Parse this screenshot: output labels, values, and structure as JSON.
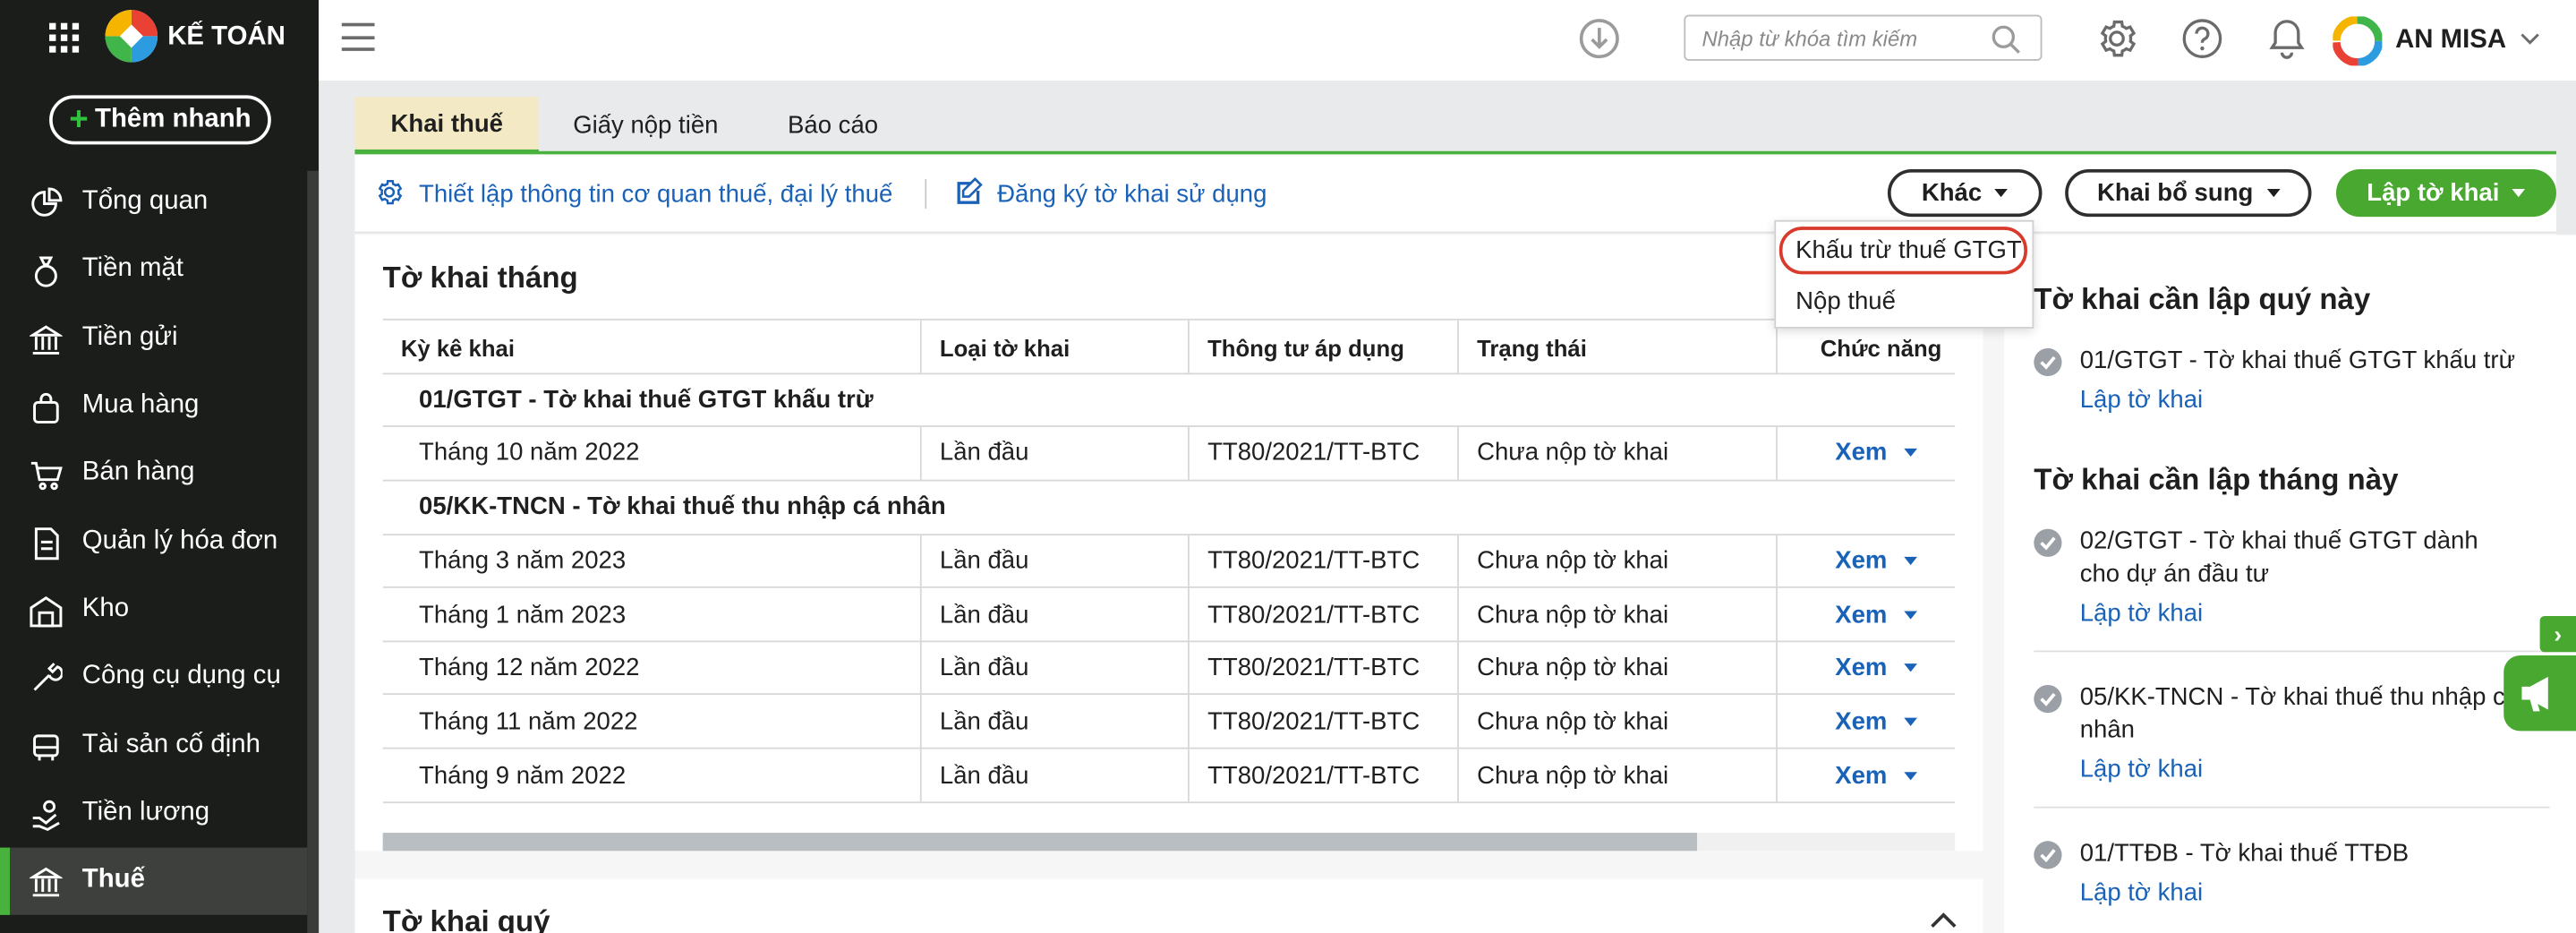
{
  "app": {
    "brand": "KẾ TOÁN",
    "quick_add": "Thêm nhanh"
  },
  "sidebar": {
    "items": [
      {
        "label": "Tổng quan",
        "icon": "chart-icon"
      },
      {
        "label": "Tiền mặt",
        "icon": "money-bag-icon"
      },
      {
        "label": "Tiền gửi",
        "icon": "bank-icon"
      },
      {
        "label": "Mua hàng",
        "icon": "shopping-bag-icon"
      },
      {
        "label": "Bán hàng",
        "icon": "cart-icon"
      },
      {
        "label": "Quản lý hóa đơn",
        "icon": "invoice-icon"
      },
      {
        "label": "Kho",
        "icon": "warehouse-icon"
      },
      {
        "label": "Công cụ dụng cụ",
        "icon": "tools-icon"
      },
      {
        "label": "Tài sản cố định",
        "icon": "asset-icon"
      },
      {
        "label": "Tiền lương",
        "icon": "salary-icon"
      },
      {
        "label": "Thuế",
        "icon": "tax-bank-icon",
        "active": true
      }
    ]
  },
  "header": {
    "search_placeholder": "Nhập từ khóa tìm kiếm",
    "user_name": "AN MISA"
  },
  "tabs": [
    "Khai thuế",
    "Giấy nộp tiền",
    "Báo cáo"
  ],
  "toolbar": {
    "setup_link": "Thiết lập thông tin cơ quan thuế, đại lý thuế",
    "register_link": "Đăng ký tờ khai sử dụng",
    "other_button": "Khác",
    "supplement_button": "Khai bổ sung",
    "create_button": "Lập tờ khai"
  },
  "dropdown": {
    "items": [
      "Khấu trừ thuế GTGT",
      "Nộp thuế"
    ]
  },
  "monthly": {
    "title": "Tờ khai tháng",
    "columns": [
      "Kỳ kê khai",
      "Loại tờ khai",
      "Thông tư áp dụng",
      "Trạng thái",
      "Chức năng"
    ],
    "groups": [
      "01/GTGT - Tờ khai thuế GTGT khấu trừ",
      "05/KK-TNCN - Tờ khai thuế thu nhập cá nhân"
    ],
    "rows": [
      {
        "period": "Tháng 10 năm 2022",
        "type": "Lần đầu",
        "circular": "TT80/2021/TT-BTC",
        "status": "Chưa nộp tờ khai",
        "action": "Xem"
      },
      {
        "period": "Tháng 3 năm 2023",
        "type": "Lần đầu",
        "circular": "TT80/2021/TT-BTC",
        "status": "Chưa nộp tờ khai",
        "action": "Xem"
      },
      {
        "period": "Tháng 1 năm 2023",
        "type": "Lần đầu",
        "circular": "TT80/2021/TT-BTC",
        "status": "Chưa nộp tờ khai",
        "action": "Xem"
      },
      {
        "period": "Tháng 12 năm 2022",
        "type": "Lần đầu",
        "circular": "TT80/2021/TT-BTC",
        "status": "Chưa nộp tờ khai",
        "action": "Xem"
      },
      {
        "period": "Tháng 11 năm 2022",
        "type": "Lần đầu",
        "circular": "TT80/2021/TT-BTC",
        "status": "Chưa nộp tờ khai",
        "action": "Xem"
      },
      {
        "period": "Tháng 9 năm 2022",
        "type": "Lần đầu",
        "circular": "TT80/2021/TT-BTC",
        "status": "Chưa nộp tờ khai",
        "action": "Xem"
      }
    ]
  },
  "quarterly": {
    "title": "Tờ khai quý"
  },
  "right_panel": {
    "quarter_title": "Tờ khai cần lập quý này",
    "month_title": "Tờ khai cần lập tháng này",
    "create_link": "Lập tờ khai",
    "quarter_items": [
      "01/GTGT - Tờ khai thuế GTGT khấu trừ"
    ],
    "month_items": [
      "02/GTGT - Tờ khai thuế GTGT dành cho dự án đầu tư",
      "05/KK-TNCN - Tờ khai thuế thu nhập cá nhân",
      "01/TTĐB - Tờ khai thuế TTĐB"
    ]
  },
  "colors": {
    "accent_green": "#49a82f",
    "link_blue": "#1a62b7",
    "sidebar_bg": "#1b1d1b",
    "highlight_red": "#d83a2c"
  }
}
